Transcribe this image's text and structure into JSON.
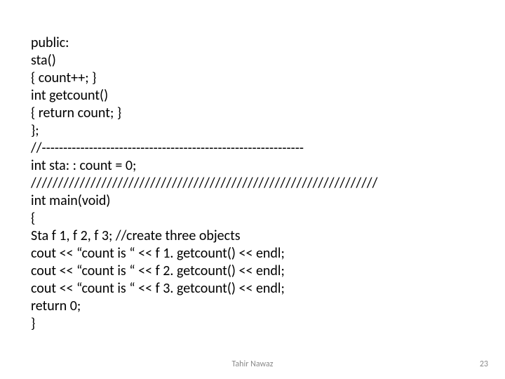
{
  "code": {
    "lines": [
      "public:",
      "sta()",
      "{ count++; }",
      "int getcount()",
      "{ return count; }",
      "};",
      "//-------------------------------------------------------------",
      "int sta: : count = 0;",
      "////////////////////////////////////////////////////////////////",
      "int main(void)",
      "{",
      "Sta f 1, f 2, f 3; //create three objects",
      "cout << “count is “ << f 1. getcount() << endl;",
      "cout << “count is “ << f 2. getcount() << endl;",
      "cout << “count is “ << f 3. getcount() << endl;",
      "return 0;",
      "}"
    ]
  },
  "footer": {
    "author": "Tahir Nawaz",
    "page": "23"
  }
}
